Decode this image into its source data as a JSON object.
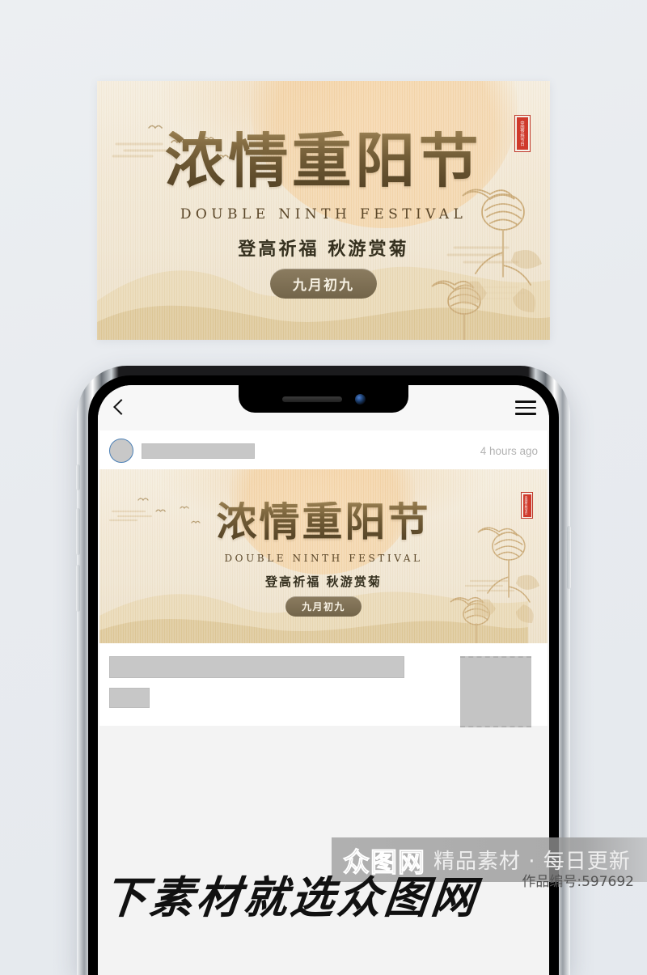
{
  "page": {
    "background_color": "#eaedf1"
  },
  "hero_banner": {
    "title": "浓情重阳节",
    "subtitle_en": "DOUBLE NINTH FESTIVAL",
    "slogan": "登高祈福  秋游赏菊",
    "date_pill": "九月初九",
    "stamp_text": "中国传统节日",
    "colors": {
      "paper": "#f1e6d2",
      "ink": "#4c3d22",
      "pill": "#73654a",
      "stamp_red": "#cf3a2c"
    }
  },
  "phone": {
    "topbar": {
      "back_icon": "chevron-left-icon",
      "menu_icon": "hamburger-menu-icon"
    },
    "notch": {
      "speaker_icon": "earpiece-speaker",
      "camera_icon": "front-camera"
    },
    "post": {
      "avatar_icon": "user-avatar-placeholder",
      "author_placeholder": "",
      "timestamp": "4 hours ago"
    },
    "banner": {
      "title": "浓情重阳节",
      "subtitle_en": "DOUBLE NINTH FESTIVAL",
      "slogan": "登高祈福  秋游赏菊",
      "date_pill": "九月初九",
      "stamp_text": "中国传统节日"
    },
    "body": {
      "text_line_placeholder": "",
      "tag_placeholder": "",
      "thumbnail_placeholder": ""
    }
  },
  "watermark": {
    "logo": "众图网",
    "tagline": "精品素材 · 每日更新",
    "work_id": "作品编号:597692",
    "headline": "下素材就选众图网"
  }
}
